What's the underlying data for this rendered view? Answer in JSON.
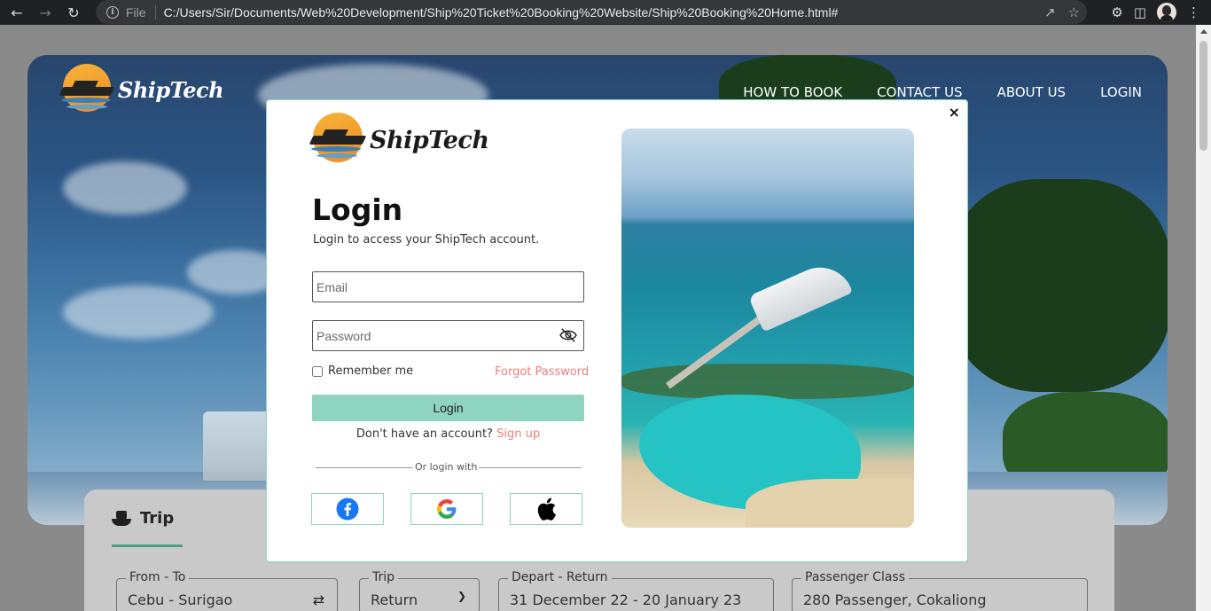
{
  "browser": {
    "file_label": "File",
    "url": "C:/Users/Sir/Documents/Web%20Development/Ship%20Ticket%20Booking%20Website/Ship%20Booking%20Home.html#"
  },
  "site": {
    "brand": "ShipTech",
    "nav": [
      "HOW TO BOOK",
      "CONTACT US",
      "ABOUT US",
      "LOGIN"
    ]
  },
  "booking": {
    "tab_label": "Trip",
    "fields": [
      {
        "label": "From - To",
        "value": "Cebu - Surigao"
      },
      {
        "label": "Trip",
        "value": "Return"
      },
      {
        "label": "Depart - Return",
        "value": "31 December 22 - 20 January 23"
      },
      {
        "label": "Passenger Class",
        "value": "280 Passenger, Cokaliong"
      }
    ]
  },
  "modal": {
    "close": "×",
    "brand": "ShipTech",
    "title": "Login",
    "subtitle": "Login to access your ShipTech account.",
    "email_placeholder": "Email",
    "password_placeholder": "Password",
    "remember_label": "Remember me",
    "forgot_label": "Forgot Password",
    "login_button": "Login",
    "no_account": "Don't have an account?",
    "signup": "Sign up",
    "or_login_with": "Or login with"
  },
  "colors": {
    "accent": "#8fd3c1",
    "link": "#f07c78"
  }
}
